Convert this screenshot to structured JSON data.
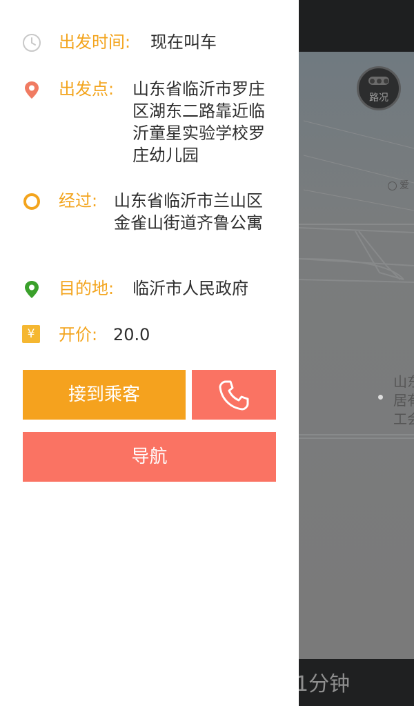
{
  "map": {
    "traffic_label": "路况",
    "poi_label": "爱",
    "poi_lines": [
      "山东",
      "居有",
      "工会"
    ],
    "eta_text": "1分钟"
  },
  "order": {
    "depart_time": {
      "label": "出发时间:",
      "value": "现在叫车",
      "icon": "clock-icon"
    },
    "origin": {
      "label": "出发点:",
      "value": "山东省临沂市罗庄区湖东二路靠近临沂童星实验学校罗庄幼儿园",
      "icon": "location-pin-icon"
    },
    "via": {
      "label": "经过:",
      "value": "山东省临沂市兰山区金雀山街道齐鲁公寓",
      "icon": "waypoint-ring-icon"
    },
    "destination": {
      "label": "目的地:",
      "value": "临沂市人民政府",
      "icon": "destination-pin-icon"
    },
    "price": {
      "label": "开价:",
      "value": "20.0",
      "icon": "yuan-icon",
      "symbol": "¥"
    }
  },
  "actions": {
    "pickup_label": "接到乘客",
    "call_icon": "phone-icon",
    "navigate_label": "导航"
  },
  "colors": {
    "label_orange": "#f3a41d",
    "pickup_button": "#f5a21e",
    "coral_button": "#fa7363",
    "origin_pin": "#f07b62",
    "destination_pin": "#3aa02b"
  }
}
